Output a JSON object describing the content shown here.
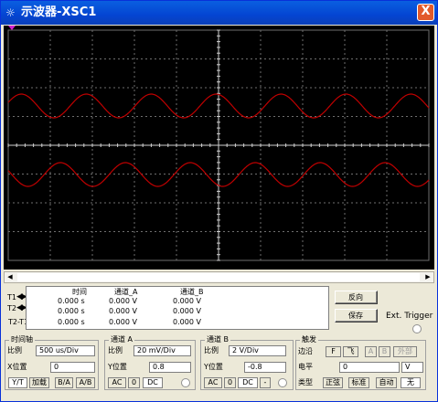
{
  "window": {
    "title": "示波器-XSC1",
    "close": "X",
    "icon": "scope-icon"
  },
  "screen": {
    "background": "#000000",
    "grid_color": "#6E6E6E",
    "trace_color": "#C00000",
    "trigger_marker_color": "#D020D0"
  },
  "readout": {
    "headers": {
      "time": "时间",
      "channel_a": "通道_A",
      "channel_b": "通道_B"
    },
    "rows": [
      {
        "label": "T1",
        "time": "0.000 s",
        "a": "0.000 V",
        "b": "0.000 V"
      },
      {
        "label": "T2",
        "time": "0.000 s",
        "a": "0.000 V",
        "b": "0.000 V"
      },
      {
        "label": "T2-T1",
        "time": "0.000 s",
        "a": "0.000 V",
        "b": "0.000 V"
      }
    ]
  },
  "buttons": {
    "reverse": "反向",
    "save": "保存",
    "ext_trigger": "Ext. Trigger"
  },
  "timebase": {
    "group": "时间轴",
    "scale_label": "比例",
    "scale_value": "500 us/Div",
    "xpos_label": "X位置",
    "xpos_value": "0",
    "modes": [
      "Y/T",
      "加载",
      "B/A",
      "A/B"
    ]
  },
  "channel_a": {
    "group": "通道 A",
    "scale_label": "比例",
    "scale_value": "20 mV/Div",
    "ypos_label": "Y位置",
    "ypos_value": "0.8",
    "coupling": [
      "AC",
      "0",
      "DC"
    ]
  },
  "channel_b": {
    "group": "通道 B",
    "scale_label": "比例",
    "scale_value": "2 V/Div",
    "ypos_label": "Y位置",
    "ypos_value": "-0.8",
    "coupling": [
      "AC",
      "0",
      "DC",
      "-"
    ]
  },
  "trigger": {
    "group": "触发",
    "edge_label": "边沿",
    "edges": [
      "F",
      "飞",
      "A",
      "B",
      "外部"
    ],
    "level_label": "电平",
    "level_value": "0",
    "level_unit": "V",
    "type_label": "类型",
    "types": [
      "正弦",
      "标准",
      "自动",
      "无"
    ]
  }
}
